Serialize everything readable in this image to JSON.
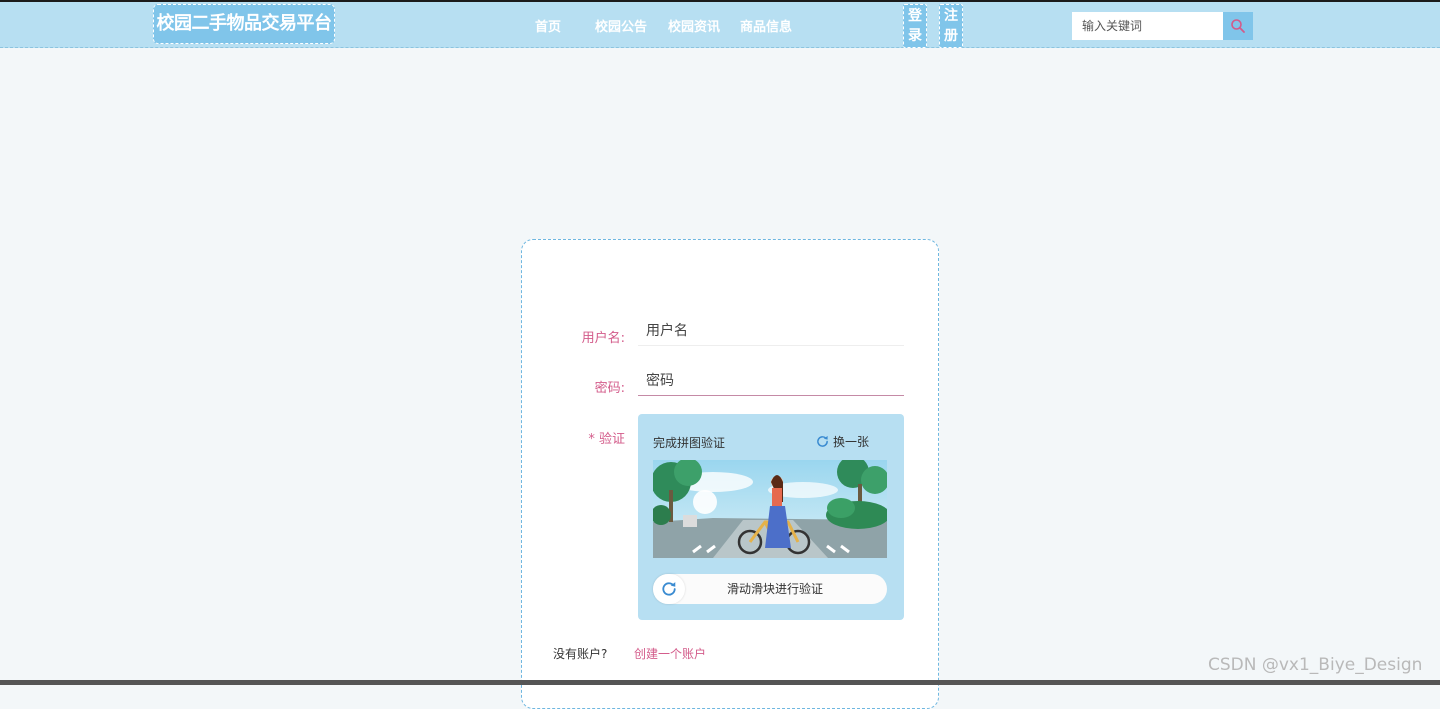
{
  "header": {
    "brand": "校园二手物品交易平台",
    "nav": [
      {
        "label": "首页"
      },
      {
        "label": "校园公告"
      },
      {
        "label": "校园资讯"
      },
      {
        "label": "商品信息"
      }
    ],
    "login_label": "登录",
    "register_label": "注册",
    "search": {
      "placeholder": "输入关键词"
    }
  },
  "form": {
    "username": {
      "label": "用户名:",
      "placeholder": "用户名"
    },
    "password": {
      "label": "密码:",
      "placeholder": "密码"
    },
    "verify": {
      "label": "* 验证"
    },
    "captcha": {
      "title": "完成拼图验证",
      "refresh_label": "换一张",
      "slider_text": "滑动滑块进行验证"
    },
    "no_account": "没有账户?",
    "create_account": "创建一个账户"
  },
  "watermark": "CSDN @vx1_Biye_Design",
  "colors": {
    "header_bg": "#b7dff2",
    "accent_blue": "#80c5ea",
    "label_pink": "#d35b8a",
    "page_bg": "#f3f7f9"
  },
  "icons": {
    "search": "search-icon",
    "refresh": "refresh-icon",
    "slider": "slider-refresh-icon"
  }
}
